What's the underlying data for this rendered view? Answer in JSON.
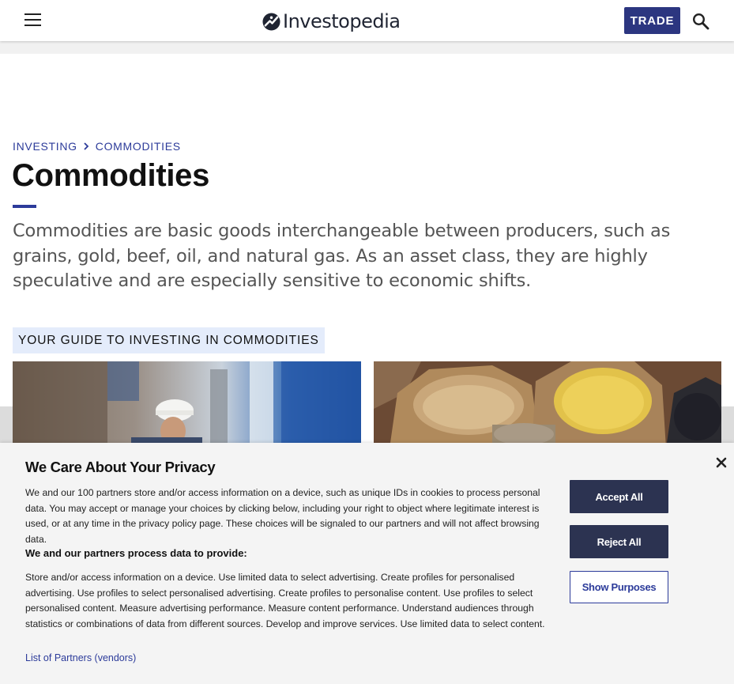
{
  "header": {
    "menu_icon": "hamburger-menu-icon",
    "logo_text": "Investopedia",
    "trade_label": "TRADE",
    "search_icon": "search-icon",
    "accent_color": "#2c3680"
  },
  "breadcrumb": {
    "items": [
      "INVESTING",
      "COMMODITIES"
    ],
    "separator_icon": "chevron-right-icon"
  },
  "page": {
    "title": "Commodities",
    "intro": "Commodities are basic goods interchangeable between producers, such as grains, gold, beef, oil, and natural gas. As an asset class, they are highly speculative and are especially sensitive to economic shifts.",
    "guide_label": "YOUR GUIDE TO INVESTING IN COMMODITIES"
  },
  "privacy": {
    "title": "We Care About Your Privacy",
    "body": "We and our 100 partners store and/or access information on a device, such as unique IDs in cookies to process personal data. You may accept or manage your choices by clicking below, including your right to object where legitimate interest is used, or at any time in the privacy policy page. These choices will be signaled to our partners and will not affect browsing data.",
    "subheading": "We and our partners process data to provide:",
    "purposes": "Store and/or access information on a device. Use limited data to select advertising. Create profiles for personalised advertising. Use profiles to select personalised advertising. Create profiles to personalise content. Use profiles to select personalised content. Measure advertising performance. Measure content performance. Understand audiences through statistics or combinations of data from different sources. Develop and improve services. Use limited data to select content.",
    "partners_link": "List of Partners (vendors)",
    "accept_label": "Accept All",
    "reject_label": "Reject All",
    "purposes_label": "Show Purposes",
    "close_icon": "close-icon"
  }
}
